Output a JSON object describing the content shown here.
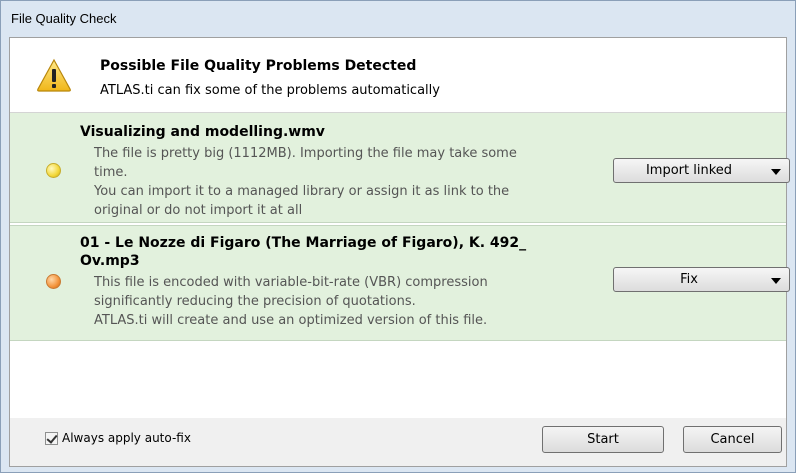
{
  "window": {
    "title": "File Quality Check"
  },
  "header": {
    "icon": "warning-icon",
    "title": "Possible File Quality Problems Detected",
    "subtitle": "ATLAS.ti can fix some of the problems automatically"
  },
  "items": [
    {
      "title": "Visualizing and modelling.wmv",
      "status_icon": "yellow-status-dot",
      "status_color": "#f3d83a",
      "description": [
        "The file is pretty big (1112MB). Importing the file may take some",
        "time.",
        "You can import it to a managed library or assign it as link to the",
        "original or do not import it at all"
      ],
      "action": "Import linked"
    },
    {
      "title_lines": [
        "01 - Le Nozze di Figaro (The Marriage of Figaro), K. 492_",
        "Ov.mp3"
      ],
      "status_icon": "orange-status-dot",
      "status_color": "#f3943c",
      "description": [
        "This file is encoded with variable-bit-rate (VBR) compression",
        "significantly reducing the precision of quotations.",
        "ATLAS.ti will create and use an optimized version of this file."
      ],
      "action": "Fix"
    }
  ],
  "footer": {
    "auto_fix_label": "Always apply auto-fix",
    "auto_fix_checked": true,
    "start_label": "Start",
    "cancel_label": "Cancel"
  },
  "colors": {
    "item_background": "#e2f1dd",
    "titlebar": "#dbe6f2"
  }
}
